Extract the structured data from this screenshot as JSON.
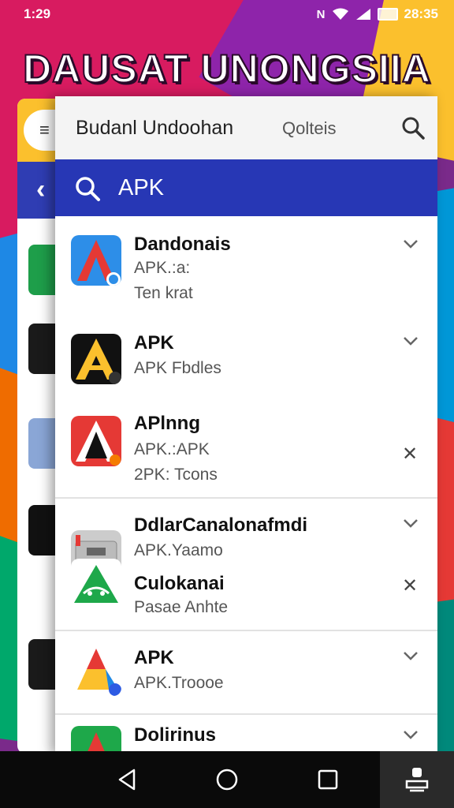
{
  "status_bar": {
    "time": "1:29",
    "clock_right": "28:35",
    "icons": [
      "nfc-icon",
      "wifi-icon",
      "signal-icon",
      "battery-icon"
    ]
  },
  "banner": {
    "text": "DAUSAT UNONGSIIA"
  },
  "back_panel": {
    "pill_label": "≡",
    "blue_label": "‹"
  },
  "panel": {
    "title": "Budanl Undoohan",
    "filter_label": "Qolteis",
    "search_value": "APK"
  },
  "items": [
    {
      "title": "Dandonais",
      "line2": "APK.:a:",
      "line3": "Ten krat",
      "action": "chevron",
      "icon": "red-blue-a-icon"
    },
    {
      "title": "APK",
      "line2": "APK Fbdles",
      "line3": "",
      "action": "chevron",
      "icon": "yellow-a-black-icon"
    },
    {
      "title": "APlnng",
      "line2": "APK.:APK",
      "line3": "2PK: Tcons",
      "action": "close",
      "icon": "red-a-white-icon"
    },
    {
      "title": "DdlarCanalonafmdi",
      "line2": "APK.Yaamo",
      "line3": "",
      "action": "chevron",
      "icon": "toolbox-icon"
    },
    {
      "title": "Culokanai",
      "line2": "Pasae Anhte",
      "line3": "",
      "action": "close",
      "icon": "green-android-icon"
    },
    {
      "title": "APK",
      "line2": "APK.Troooe",
      "line3": "",
      "action": "chevron",
      "icon": "multicolor-a-icon"
    },
    {
      "title": "Dolirinus",
      "line2": "",
      "line3": "",
      "action": "chevron",
      "icon": "green-a-icon"
    }
  ],
  "nav": {
    "buttons": [
      "back-icon",
      "home-icon",
      "recents-icon",
      "assistant-icon"
    ]
  },
  "colors": {
    "accent_blue": "#2737b5",
    "panel_bg": "#ffffff",
    "nav_bg": "#0a0a0a"
  }
}
